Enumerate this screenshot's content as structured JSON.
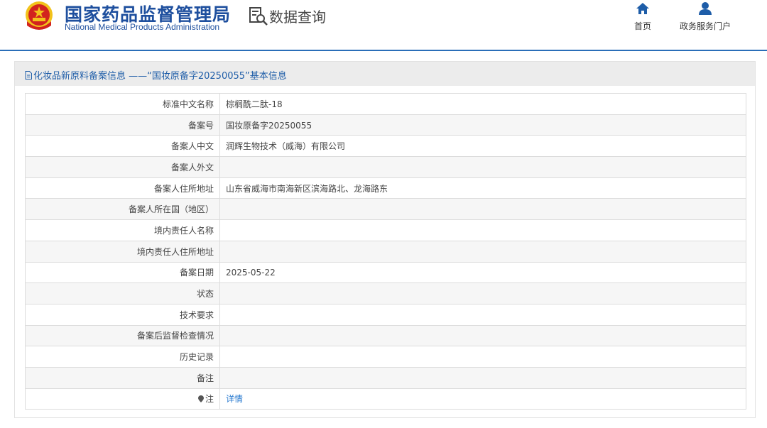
{
  "header": {
    "brand_cn": "国家药品监督管理局",
    "brand_en": "National Medical Products Administration",
    "query_title": "数据查询",
    "nav": [
      {
        "label": "首页",
        "icon": "home-icon"
      },
      {
        "label": "政务服务门户",
        "icon": "user-icon"
      }
    ]
  },
  "panel": {
    "title": "化妆品新原料备案信息 ——“国妆原备字20250055”基本信息"
  },
  "rows": [
    {
      "label": "标准中文名称",
      "value": "棕榈酰二肽-18"
    },
    {
      "label": "备案号",
      "value": "国妆原备字20250055"
    },
    {
      "label": "备案人中文",
      "value": "润辉生物技术（威海）有限公司"
    },
    {
      "label": "备案人外文",
      "value": ""
    },
    {
      "label": "备案人住所地址",
      "value": "山东省威海市南海新区滨海路北、龙海路东"
    },
    {
      "label": "备案人所在国（地区）",
      "value": ""
    },
    {
      "label": "境内责任人名称",
      "value": ""
    },
    {
      "label": "境内责任人住所地址",
      "value": ""
    },
    {
      "label": "备案日期",
      "value": "2025-05-22"
    },
    {
      "label": "状态",
      "value": ""
    },
    {
      "label": "技术要求",
      "value": ""
    },
    {
      "label": "备案后监督检查情况",
      "value": ""
    },
    {
      "label": "历史记录",
      "value": ""
    },
    {
      "label": "备注",
      "value": ""
    }
  ],
  "note_row": {
    "label": "注",
    "link": "详情",
    "icon": "pin-icon"
  },
  "colors": {
    "brand_blue": "#1e4f9e",
    "link_blue": "#2a7bd0",
    "emblem_red": "#d2231e",
    "emblem_gold": "#f2c21b"
  }
}
